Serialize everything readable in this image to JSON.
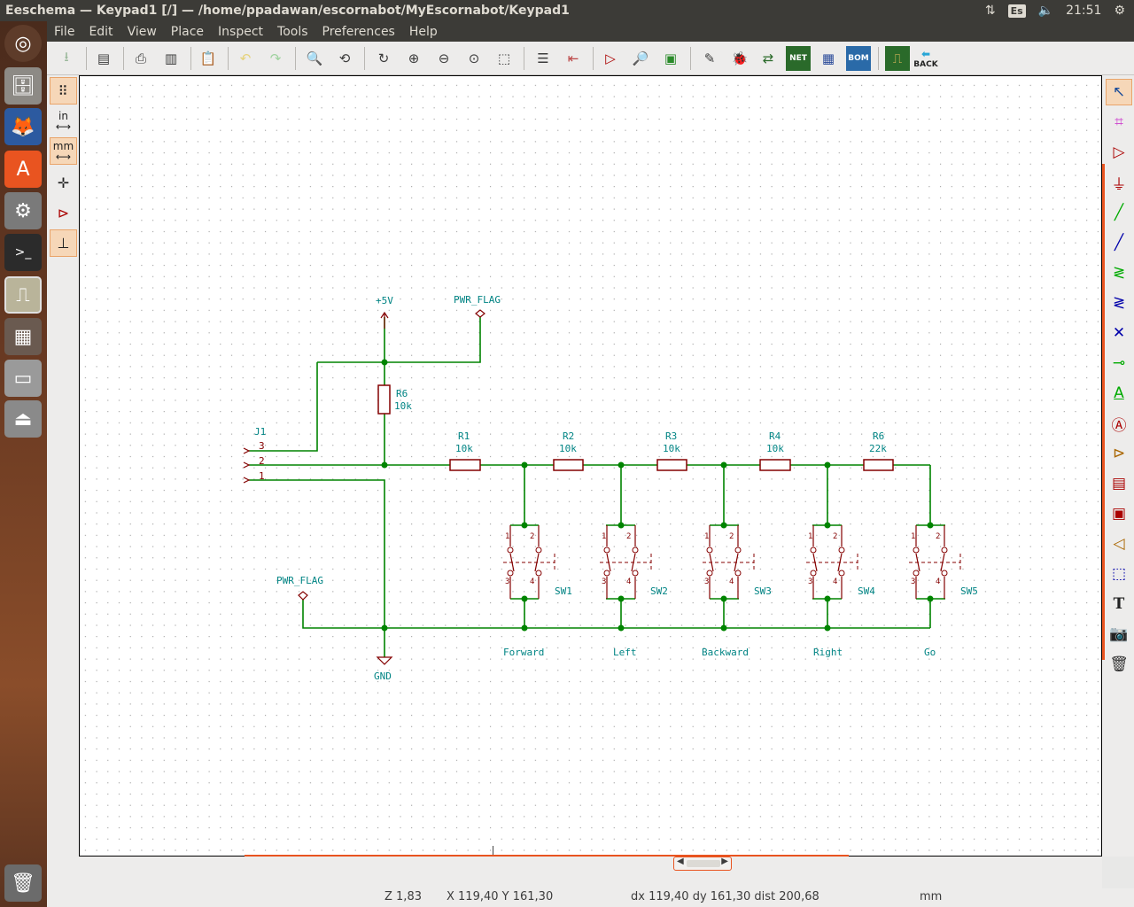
{
  "window": {
    "title": "Eeschema — Keypad1 [/] — /home/ppadawan/escornabot/MyEscornabot/Keypad1"
  },
  "tray": {
    "keyboard": "Es",
    "time": "21:51"
  },
  "menu": [
    "File",
    "Edit",
    "View",
    "Place",
    "Inspect",
    "Tools",
    "Preferences",
    "Help"
  ],
  "toolbar": {
    "back_label": "BACK",
    "net_label": "NET",
    "bom_label": "BOM"
  },
  "left_toolbar": {
    "inch_label": "in",
    "mm_label": "mm"
  },
  "schematic": {
    "power": {
      "vcc": "+5V",
      "gnd": "GND",
      "pwr_flag": "PWR_FLAG"
    },
    "connector": {
      "ref": "J1",
      "pins": [
        "3",
        "2",
        "1"
      ]
    },
    "resistors": [
      {
        "ref": "R6",
        "value": "10k"
      },
      {
        "ref": "R1",
        "value": "10k"
      },
      {
        "ref": "R2",
        "value": "10k"
      },
      {
        "ref": "R3",
        "value": "10k"
      },
      {
        "ref": "R4",
        "value": "10k"
      },
      {
        "ref": "R6",
        "value": "22k"
      }
    ],
    "switches": [
      {
        "ref": "SW1",
        "label": "Forward"
      },
      {
        "ref": "SW2",
        "label": "Left"
      },
      {
        "ref": "SW3",
        "label": "Backward"
      },
      {
        "ref": "SW4",
        "label": "Right"
      },
      {
        "ref": "SW5",
        "label": "Go"
      }
    ],
    "switch_pins": {
      "p1": "1",
      "p2": "2",
      "p3": "3",
      "p4": "4"
    }
  },
  "status": {
    "zoom": "Z 1,83",
    "xy": "X 119,40  Y 161,30",
    "delta": "dx 119,40  dy 161,30  dist 200,68",
    "units": "mm"
  },
  "colors": {
    "wire": "#008400",
    "component": "#840000",
    "label": "#008484",
    "grid": "#848484",
    "accent": "#e95420"
  }
}
